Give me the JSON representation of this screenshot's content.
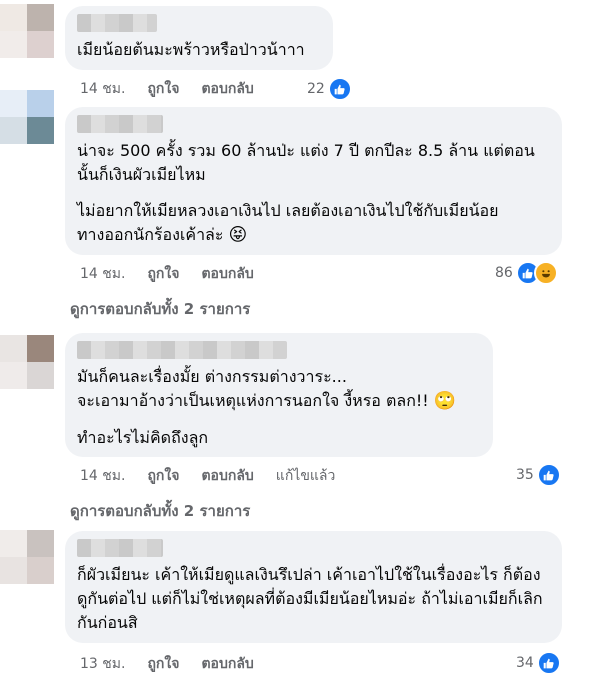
{
  "comments": [
    {
      "paragraphs": [
        "เมียน้อยต้นมะพร้าวหรือป่าวน้าาา"
      ],
      "time": "14 ชม.",
      "like": "ถูกใจ",
      "reply": "ตอบกลับ",
      "reactions": "22"
    },
    {
      "paragraphs": [
        "น่าจะ 500 ครั้ง รวม 60 ล้านป่ะ แต่ง 7 ปี ตกปีละ 8.5 ล้าน แต่ตอนนั้นก็เงินผัวเมียไหม",
        "ไม่อยากให้เมียหลวงเอาเงินไป เลยต้องเอาเงินไปใช้กับเมียน้อยทางออกนักร้องเค้าล่ะ"
      ],
      "emoji": "😝",
      "time": "14 ชม.",
      "like": "ถูกใจ",
      "reply": "ตอบกลับ",
      "reactions": "86",
      "replies_link": "ดูการตอบกลับทั้ง 2 รายการ"
    },
    {
      "paragraphs": [
        "มันก็คนละเรื่องมั้ย ต่างกรรมต่างวาระ...\nจะเอามาอ้างว่าเป็นเหตุแห่งการนอกใจ งี้หรอ ตลก!!",
        "ทำอะไรไม่คิดถึงลูก"
      ],
      "emoji": "🙄",
      "time": "14 ชม.",
      "like": "ถูกใจ",
      "reply": "ตอบกลับ",
      "edited": "แก้ไขแล้ว",
      "reactions": "35",
      "replies_link": "ดูการตอบกลับทั้ง 2 รายการ"
    },
    {
      "paragraphs": [
        "ก็ผัวเมียนะ เค้าให้เมียดูแลเงินรึเปล่า เค้าเอาไปใช้ในเรื่องอะไร ก็ต้องดูกันต่อไป แต่ก็ไม่ใช่เหตุผลที่ต้องมีเมียน้อยไหมอ่ะ ถ้าไม่เอาเมียก็เลิกกันก่อนสิ"
      ],
      "time": "13 ชม.",
      "like": "ถูกใจ",
      "reply": "ตอบกลับ",
      "reactions": "34"
    }
  ],
  "colors": {
    "bubble": "#f0f2f5",
    "meta": "#65676b",
    "like_blue": "#1877f2",
    "haha_yellow": "#f7b125"
  }
}
